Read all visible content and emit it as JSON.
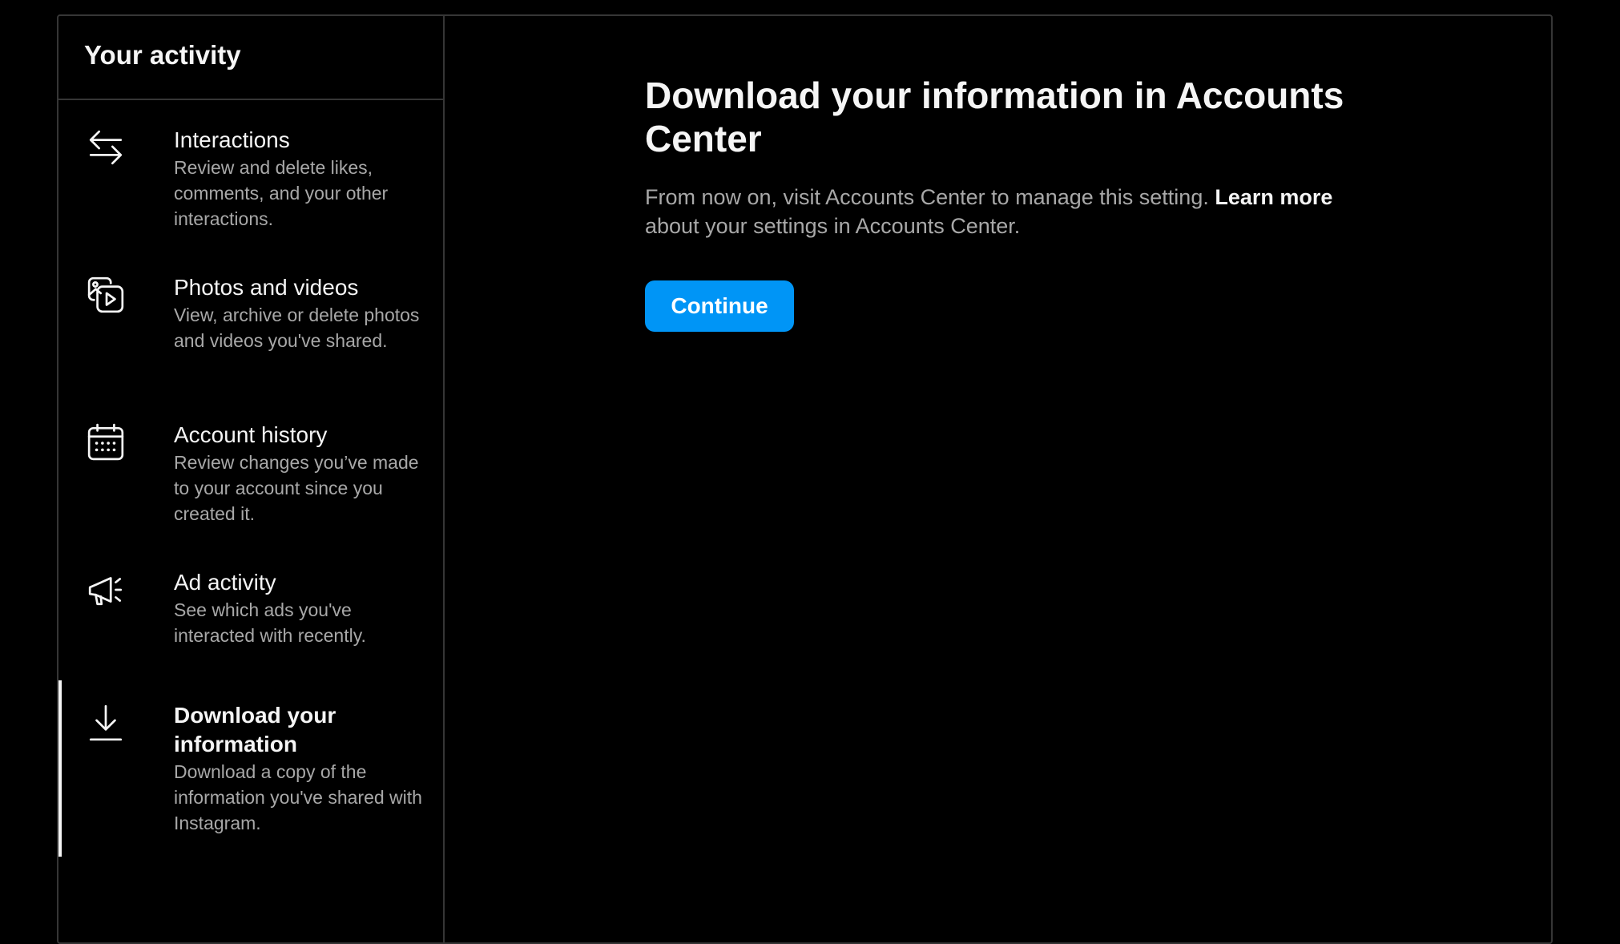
{
  "sidebar": {
    "title": "Your activity",
    "items": [
      {
        "label": "Interactions",
        "description": "Review and delete likes, comments, and your other interactions.",
        "icon": "interactions-arrows-icon",
        "active": false
      },
      {
        "label": "Photos and videos",
        "description": "View, archive or delete photos and videos you've shared.",
        "icon": "photos-videos-icon",
        "active": false
      },
      {
        "label": "Account history",
        "description": "Review changes you’ve made to your account since you created it.",
        "icon": "calendar-icon",
        "active": false
      },
      {
        "label": "Ad activity",
        "description": "See which ads you've interacted with recently.",
        "icon": "megaphone-icon",
        "active": false
      },
      {
        "label": "Download your information",
        "description": "Download a copy of the information you've shared with Instagram.",
        "icon": "download-icon",
        "active": true
      }
    ]
  },
  "main": {
    "title": "Download your information in Accounts Center",
    "description_before": "From now on, visit Accounts Center to manage this setting. ",
    "description_link": "Learn more",
    "description_after": " about your settings in Accounts Center.",
    "button_label": "Continue"
  },
  "colors": {
    "background": "#000000",
    "border": "#363636",
    "text_primary": "#f5f5f5",
    "text_secondary": "#a8a8a8",
    "accent": "#0095f6"
  }
}
